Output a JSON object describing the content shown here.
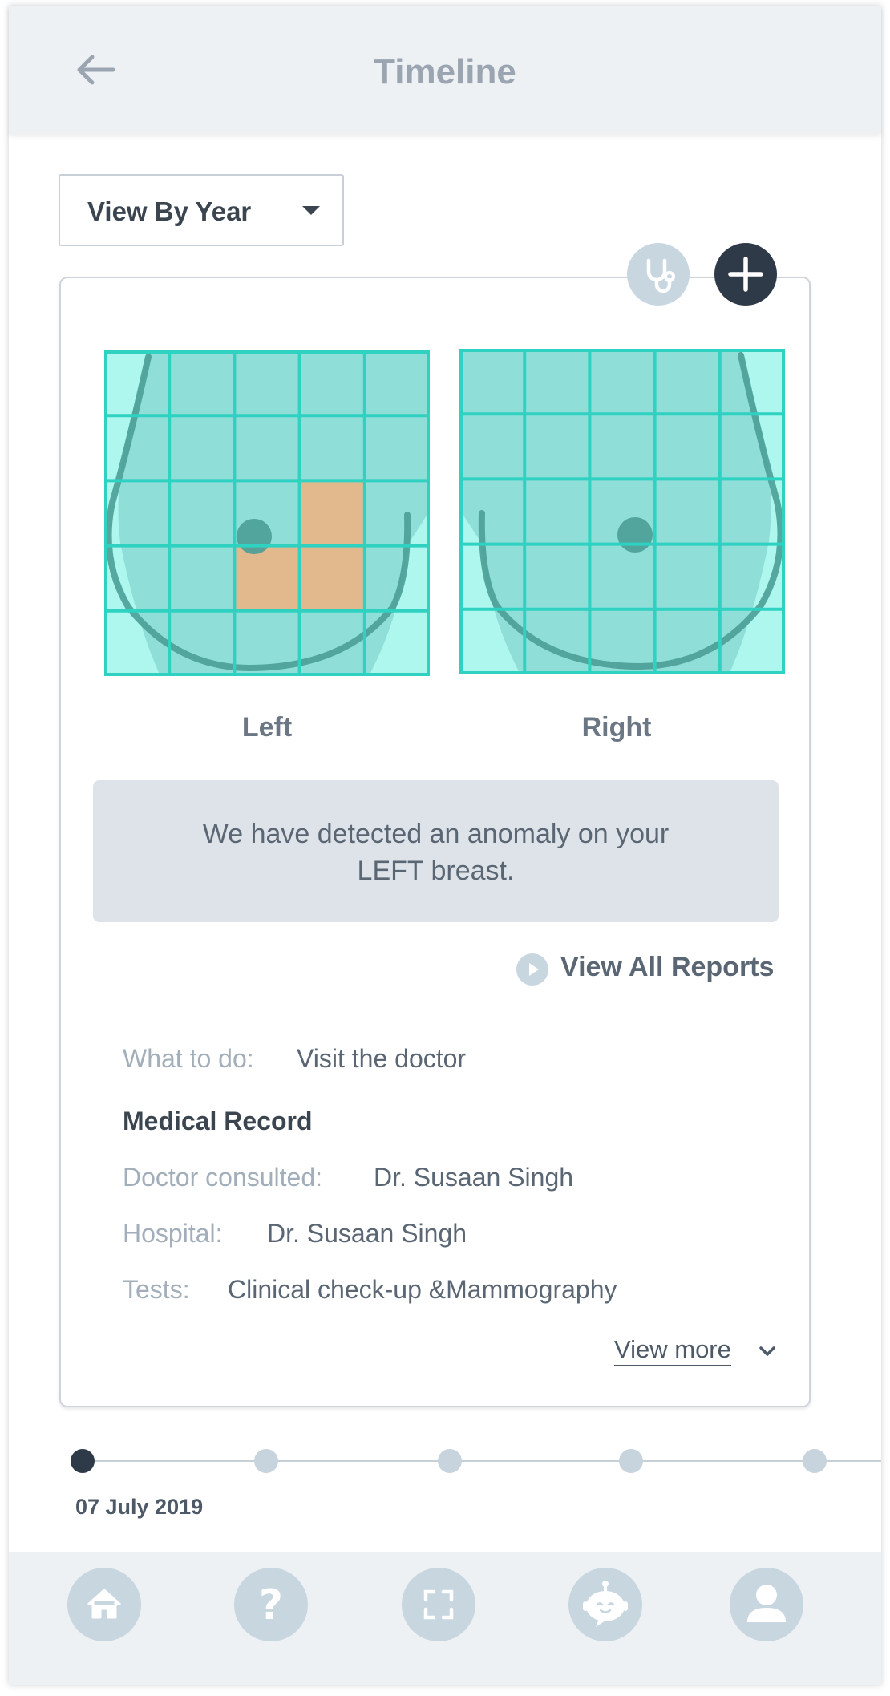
{
  "header": {
    "title": "Timeline",
    "back_icon": "arrow-left-icon"
  },
  "filter": {
    "selected": "View By Year"
  },
  "card": {
    "actions": {
      "stethoscope_icon": "stethoscope-icon",
      "add_icon": "plus-icon"
    },
    "diagrams": {
      "left_label": "Left",
      "right_label": "Right",
      "grid": "5x5",
      "left_highlighted_cells": [
        [
          2,
          3
        ],
        [
          3,
          2
        ],
        [
          3,
          3
        ]
      ],
      "colors": {
        "cell": "#8fded8",
        "grid_line": "#2fd1c1",
        "highlight": "#e2b98d",
        "outline": "#4a9e97"
      }
    },
    "alert": "We have detected an anomaly on your LEFT breast.",
    "reports_link": "View All Reports",
    "what_to_do": {
      "label": "What to do:",
      "value": "Visit the doctor"
    },
    "medical_record": {
      "title": "Medical Record",
      "doctor": {
        "label": "Doctor consulted:",
        "value": "Dr. Susaan Singh"
      },
      "hospital": {
        "label": "Hospital:",
        "value": "Dr. Susaan Singh"
      },
      "tests": {
        "label": "Tests:",
        "value": "Clinical check-up &Mammography"
      }
    },
    "view_more": "View more"
  },
  "timeline": {
    "active_date": "07 July 2019",
    "dot_count": 5,
    "active_index": 0
  },
  "bottom_nav": [
    "home-icon",
    "help-icon",
    "scan-icon",
    "bot-icon",
    "profile-icon"
  ],
  "colors": {
    "accent_dark": "#2f3a48",
    "muted_circle": "#c8d6e0",
    "bar_bg": "#eef1f4"
  }
}
